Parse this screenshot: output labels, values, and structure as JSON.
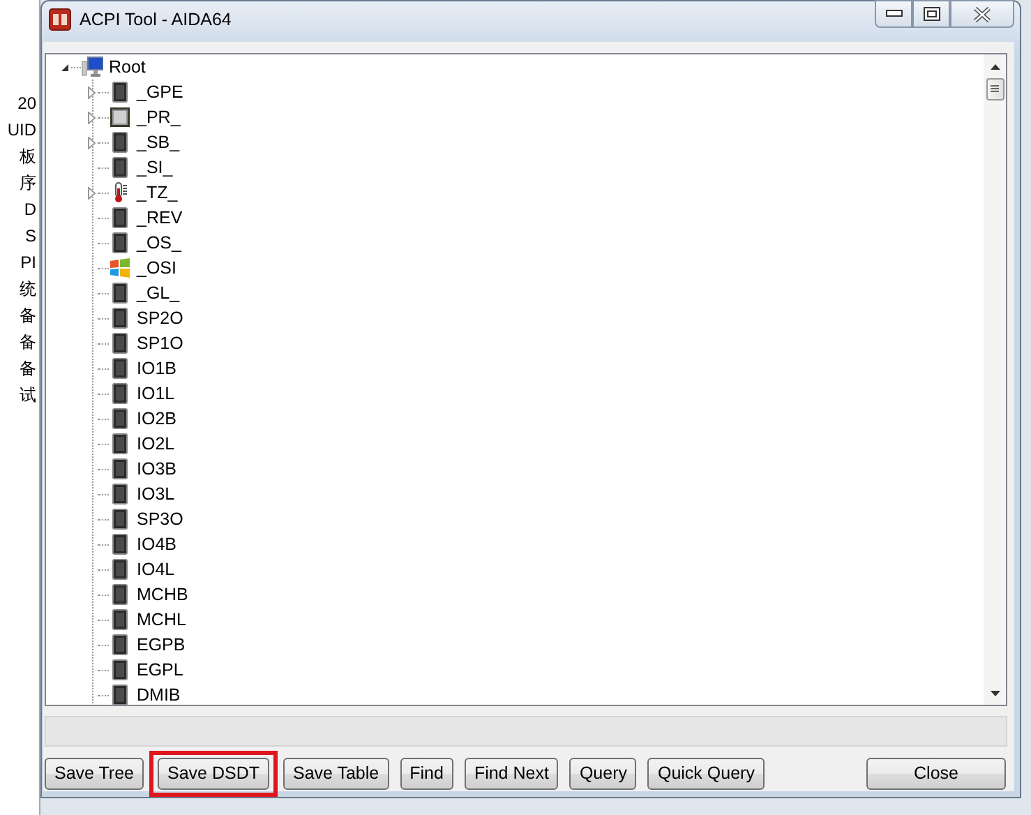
{
  "background_app": {
    "labels": [
      "20",
      "UID",
      "板",
      "序",
      "D",
      "S",
      "PI",
      "统",
      "备",
      "备",
      "备",
      "试"
    ]
  },
  "window": {
    "title": "ACPI Tool - AIDA64"
  },
  "tree": [
    {
      "label": "Root",
      "kind": "computer",
      "expanded": true,
      "children": [
        {
          "label": "_GPE",
          "kind": "device",
          "expanded": false
        },
        {
          "label": "_PR_",
          "kind": "processor",
          "expanded": false
        },
        {
          "label": "_SB_",
          "kind": "device",
          "expanded": false
        },
        {
          "label": "_SI_",
          "kind": "device"
        },
        {
          "label": "_TZ_",
          "kind": "thermal",
          "expanded": false
        },
        {
          "label": "_REV",
          "kind": "device"
        },
        {
          "label": "_OS_",
          "kind": "device"
        },
        {
          "label": "_OSI",
          "kind": "os"
        },
        {
          "label": "_GL_",
          "kind": "device"
        },
        {
          "label": "SP2O",
          "kind": "device"
        },
        {
          "label": "SP1O",
          "kind": "device"
        },
        {
          "label": "IO1B",
          "kind": "device"
        },
        {
          "label": "IO1L",
          "kind": "device"
        },
        {
          "label": "IO2B",
          "kind": "device"
        },
        {
          "label": "IO2L",
          "kind": "device"
        },
        {
          "label": "IO3B",
          "kind": "device"
        },
        {
          "label": "IO3L",
          "kind": "device"
        },
        {
          "label": "SP3O",
          "kind": "device"
        },
        {
          "label": "IO4B",
          "kind": "device"
        },
        {
          "label": "IO4L",
          "kind": "device"
        },
        {
          "label": "MCHB",
          "kind": "device"
        },
        {
          "label": "MCHL",
          "kind": "device"
        },
        {
          "label": "EGPB",
          "kind": "device"
        },
        {
          "label": "EGPL",
          "kind": "device"
        },
        {
          "label": "DMIB",
          "kind": "device"
        }
      ]
    }
  ],
  "buttons": [
    {
      "label": "Save Tree",
      "highlighted": false
    },
    {
      "label": "Save DSDT",
      "highlighted": true
    },
    {
      "label": "Save Table",
      "highlighted": false
    },
    {
      "label": "Find",
      "highlighted": false
    },
    {
      "label": "Find Next",
      "highlighted": false
    },
    {
      "label": "Query",
      "highlighted": false
    },
    {
      "label": "Quick Query",
      "highlighted": false
    },
    {
      "label": "Close",
      "highlighted": false
    }
  ]
}
